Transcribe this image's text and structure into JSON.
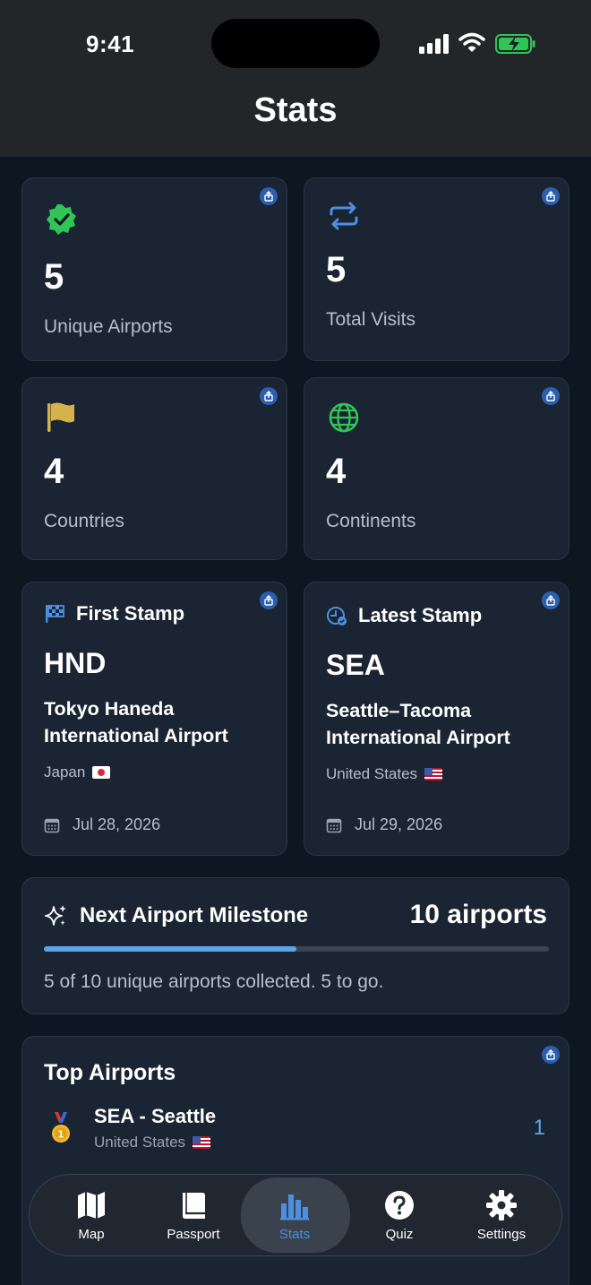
{
  "status": {
    "time": "9:41"
  },
  "header": {
    "title": "Stats"
  },
  "stats": [
    {
      "value": "5",
      "label": "Unique Airports",
      "icon": "verified-badge-icon",
      "color": "#30c557"
    },
    {
      "value": "5",
      "label": "Total Visits",
      "icon": "repeat-icon",
      "color": "#4d8fe0"
    },
    {
      "value": "4",
      "label": "Countries",
      "icon": "flag-icon",
      "color": "#d6b24a"
    },
    {
      "value": "4",
      "label": "Continents",
      "icon": "globe-icon",
      "color": "#30c557"
    }
  ],
  "first_stamp": {
    "heading": "First Stamp",
    "code": "HND",
    "name": "Tokyo Haneda International Airport",
    "country": "Japan",
    "date": "Jul 28, 2026"
  },
  "latest_stamp": {
    "heading": "Latest Stamp",
    "code": "SEA",
    "name": "Seattle–Tacoma International Airport",
    "country": "United States",
    "date": "Jul 29, 2026"
  },
  "milestone": {
    "title": "Next Airport Milestone",
    "goal": "10 airports",
    "progress": 0.5,
    "description": "5 of 10 unique airports collected. 5 to go."
  },
  "top_airports": {
    "title": "Top Airports",
    "items": [
      {
        "name": "SEA - Seattle",
        "country": "United States",
        "count": "1"
      }
    ]
  },
  "tabs": [
    {
      "label": "Map",
      "icon": "map-icon"
    },
    {
      "label": "Passport",
      "icon": "book-icon"
    },
    {
      "label": "Stats",
      "icon": "bar-chart-icon",
      "active": true
    },
    {
      "label": "Quiz",
      "icon": "question-icon"
    },
    {
      "label": "Settings",
      "icon": "gear-icon"
    }
  ],
  "colors": {
    "accent": "#4d8fe0",
    "card": "#1a2432",
    "background": "#0d1621"
  }
}
